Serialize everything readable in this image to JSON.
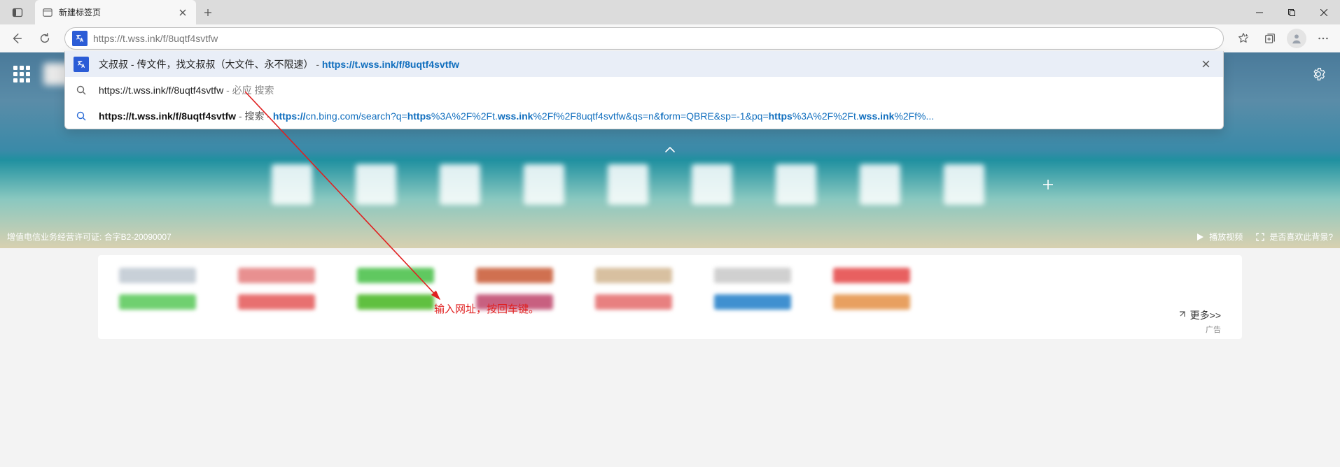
{
  "tab": {
    "title": "新建标签页"
  },
  "omnibox": {
    "value": "https://t.wss.ink/f/8uqtf4svtfw"
  },
  "suggestions": {
    "r0": {
      "title": "文叔叔 - 传文件，找文叔叔（大文件、永不限速）",
      "sep": " - ",
      "url": "https://t.wss.ink/f/8uqtf4svtfw"
    },
    "r1": {
      "text": "https://t.wss.ink/f/8uqtf4svtfw",
      "suffix": " - 必应 搜索"
    },
    "r2": {
      "pre": "https://t.wss.ink/f/8uqtf4svtfw",
      "mid": " - 搜索 - ",
      "url_a": "https://",
      "url_b": "cn.bing.com/search?q=",
      "url_c": "https",
      "url_d": "%3A%2F%2Ft.",
      "url_e": "wss.ink",
      "url_f": "%2Ff%2F8uqtf4svtfw&qs=n&",
      "url_g": "f",
      "url_h": "orm=QBRE&sp=-1&pq=",
      "url_i": "https",
      "url_j": "%3A%2F%2Ft.",
      "url_k": "wss.ink",
      "url_l": "%2Ff%..."
    }
  },
  "hero": {
    "license": "增值电信业务经营许可证: 合字B2-20090007",
    "play": "播放视频",
    "like": "是否喜欢此背景?"
  },
  "feed": {
    "more": "更多>>",
    "ad": "广告"
  },
  "annotation": "输入网址，按回车键。"
}
